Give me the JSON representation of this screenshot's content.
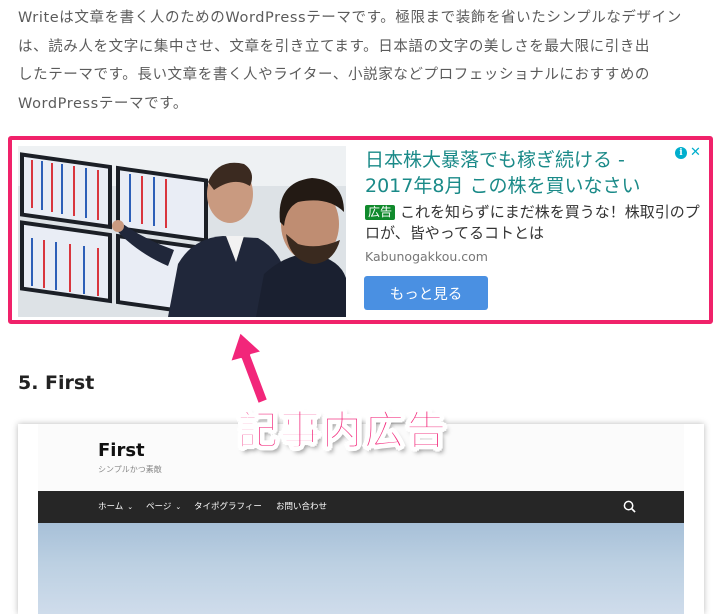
{
  "article": {
    "intro_lines": [
      "Writeは文章を書く人のためのWordPressテーマです。極限まで装飾を省いたシンプルなデザイン",
      "は、読み人を文字に集中させ、文章を引き立てます。日本語の文字の美しさを最大限に引き出",
      "したテーマです。長い文章を書く人やライター、小説家などプロフェッショナルにおすすめの",
      "WordPressテーマです。"
    ],
    "section_heading": "5. First"
  },
  "ad": {
    "headline": "日本株大暴落でも稼ぎ続ける - 2017年8月 この株を買いなさい",
    "badge": "広告",
    "description": "これを知らずにまだ株を買うな！株取引のプロが、皆やってるコトとは",
    "domain": "Kabunogakkou.com",
    "cta": "もっと見る",
    "choices_icon": "adchoices-icon",
    "close_icon": "close-icon",
    "frame_color": "#f0226a",
    "headline_color": "#1a8a88",
    "cta_color": "#4a90e2"
  },
  "annotation": {
    "label": "記事内広告",
    "color": "#f2267a"
  },
  "theme_preview": {
    "site_title": "First",
    "tagline": "シンプルかつ素敵",
    "nav": [
      {
        "label": "ホーム",
        "has_dropdown": true
      },
      {
        "label": "ページ",
        "has_dropdown": true
      },
      {
        "label": "タイポグラフィー",
        "has_dropdown": false
      },
      {
        "label": "お問い合わせ",
        "has_dropdown": false
      }
    ],
    "search_icon": "search-icon",
    "nav_bg": "#262626"
  }
}
